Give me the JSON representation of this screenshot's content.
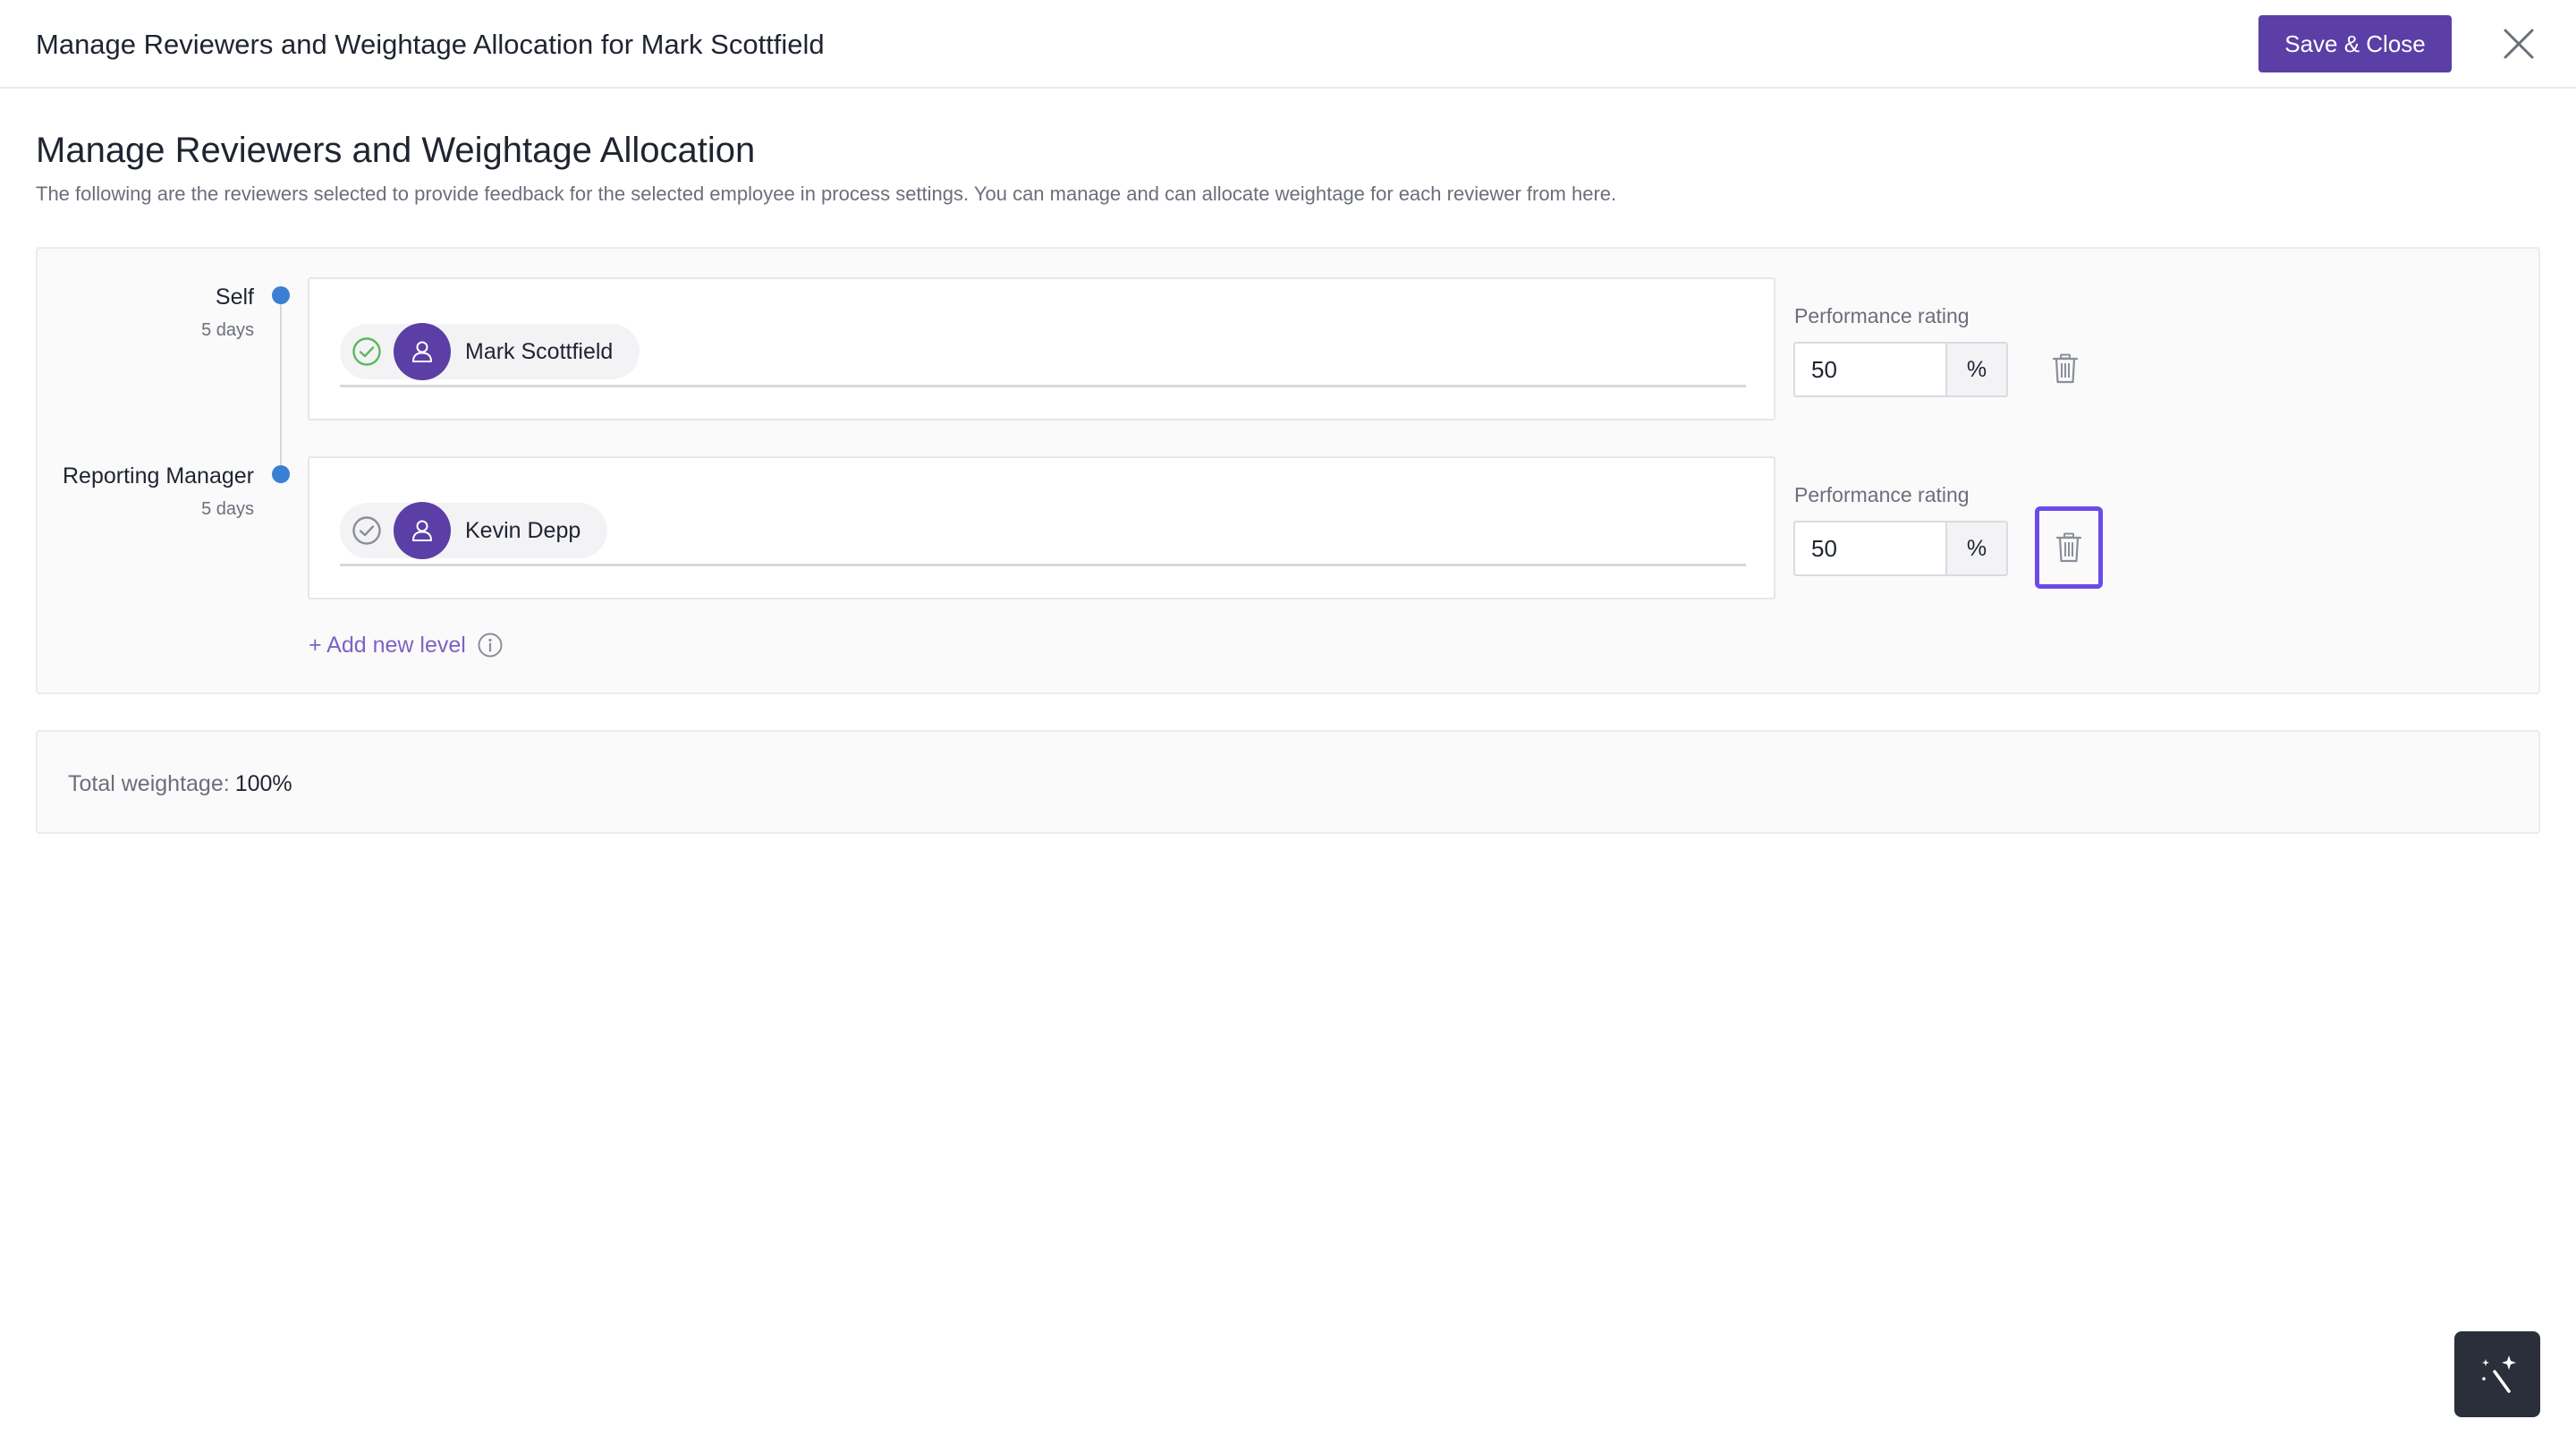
{
  "header": {
    "title": "Manage Reviewers and Weightage Allocation for Mark Scottfield",
    "save_label": "Save & Close"
  },
  "section": {
    "title": "Manage Reviewers and Weightage Allocation",
    "description": "The following are the reviewers selected to provide feedback for the selected employee in process settings. You can manage and can allocate weightage for each reviewer from here."
  },
  "levels": [
    {
      "name": "Self",
      "days": "5 days",
      "reviewer": "Mark Scottfield",
      "status_color": "#5cb85c",
      "rating_label": "Performance rating",
      "rating_value": "50",
      "rating_unit": "%"
    },
    {
      "name": "Reporting Manager",
      "days": "5 days",
      "reviewer": "Kevin Depp",
      "status_color": "#8a8f9a",
      "rating_label": "Performance rating",
      "rating_value": "50",
      "rating_unit": "%"
    }
  ],
  "add_level_label": "+ Add new level",
  "total": {
    "label": "Total weightage:",
    "value": "100%"
  },
  "colors": {
    "primary": "#5b3fa6",
    "timeline_dot": "#3b7fd4",
    "focus_ring": "#6a4be8",
    "link": "#7b63c4"
  }
}
